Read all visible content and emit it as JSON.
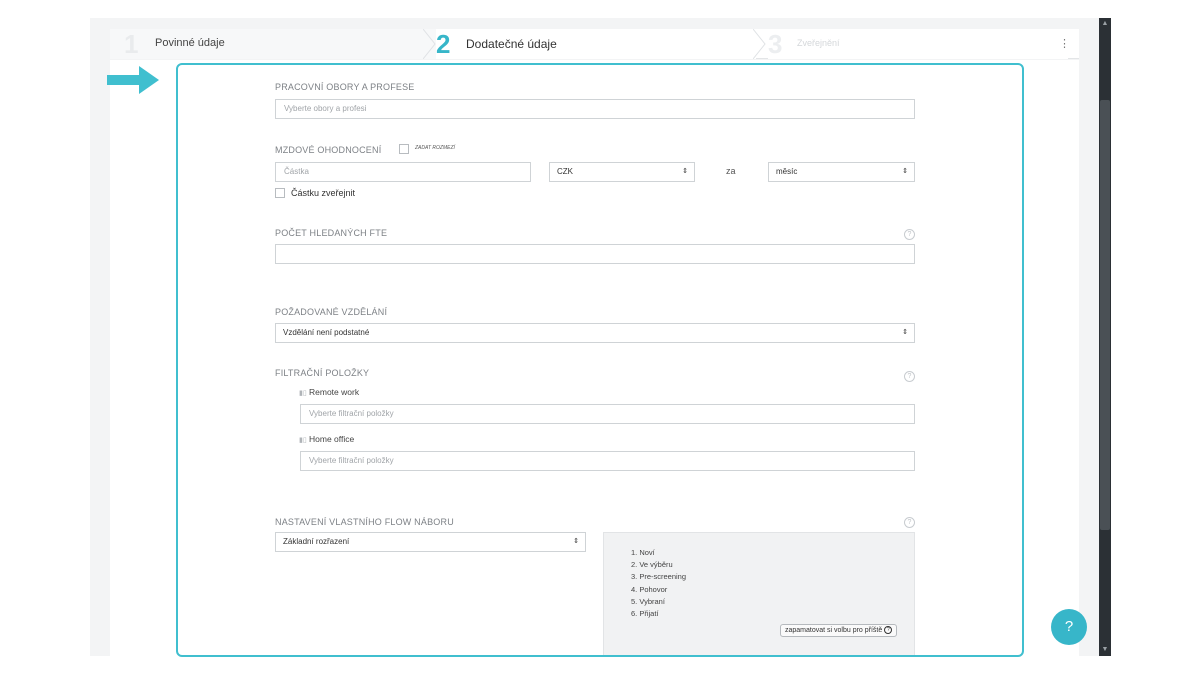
{
  "stepper": {
    "steps": [
      {
        "num": "1",
        "label": "Povinné údaje"
      },
      {
        "num": "2",
        "label": "Dodatečné údaje"
      },
      {
        "num": "3",
        "label": "Zveřejnění"
      }
    ],
    "menu_icon": "⋮"
  },
  "form": {
    "obory": {
      "title": "PRACOVNÍ OBORY A PROFESE",
      "placeholder": "Vyberte obory a profesi"
    },
    "mzda": {
      "title": "MZDOVÉ OHODNOCENÍ",
      "range_label": "ZADAT ROZMEZÍ",
      "amount_placeholder": "Částka",
      "currency": "CZK",
      "per_label": "za",
      "period": "měsíc",
      "publish_label": "Částku zveřejnit"
    },
    "fte": {
      "title": "POČET HLEDANÝCH FTE",
      "value": ""
    },
    "vzdelani": {
      "title": "POŽADOVANÉ VZDĚLÁNÍ",
      "value": "Vzdělání není podstatné"
    },
    "filtr": {
      "title": "FILTRAČNÍ POLOŽKY",
      "items": [
        {
          "label": "Remote work",
          "placeholder": "Vyberte filtrační položky"
        },
        {
          "label": "Home office",
          "placeholder": "Vyberte filtrační položky"
        }
      ]
    },
    "flow": {
      "title": "NASTAVENÍ VLASTNÍHO FLOW NÁBORU",
      "value": "Základní rozřazení",
      "stages": [
        "1. Noví",
        "2. Ve výběru",
        "3. Pre-screening",
        "4. Pohovor",
        "5. Vybraní",
        "6. Přijatí"
      ],
      "remember_label": "zapamatovat si volbu pro příště"
    }
  },
  "help_fab": "?",
  "colors": {
    "accent": "#37b6c9",
    "frame": "#40bfcf"
  }
}
